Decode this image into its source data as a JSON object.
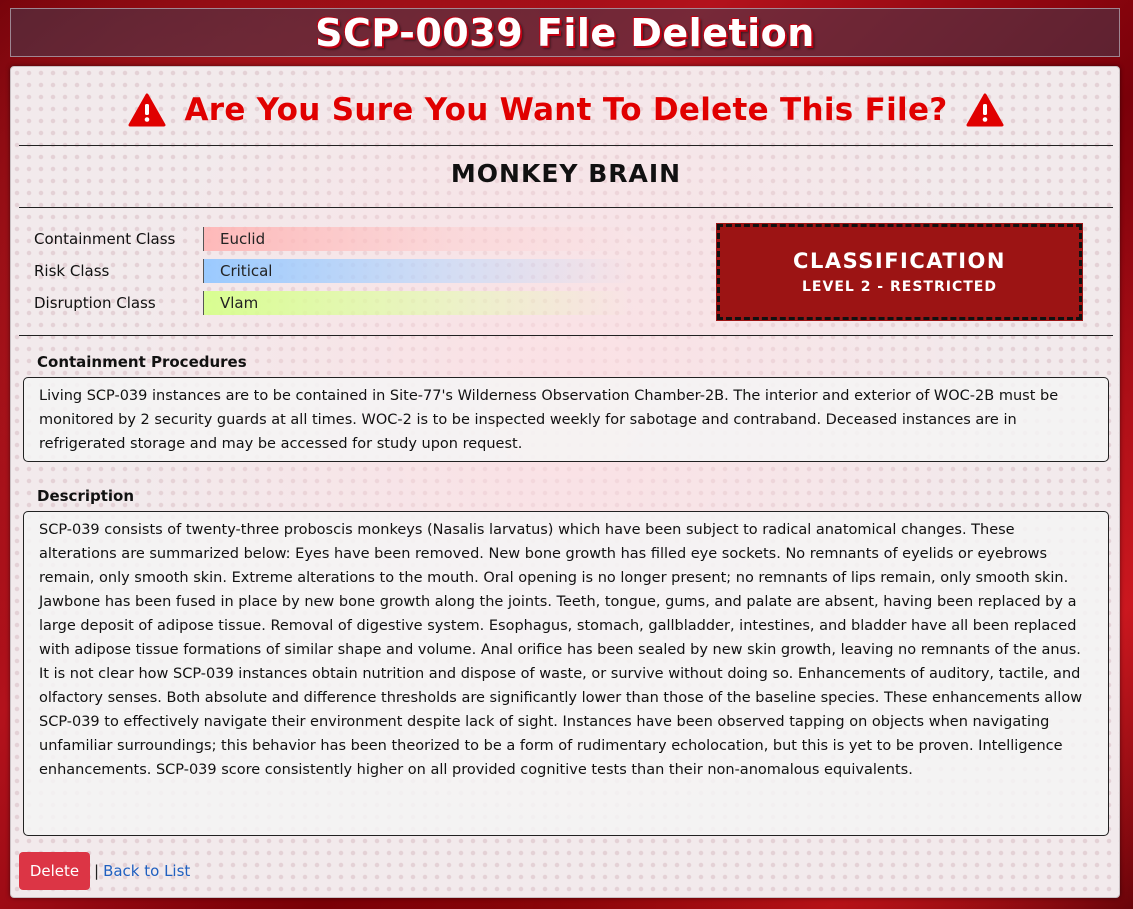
{
  "header": {
    "title": "SCP-0039 File Deletion"
  },
  "confirm": {
    "title": "Are You Sure You Want To Delete This File?"
  },
  "file": {
    "name": "MONKEY BRAIN"
  },
  "classes": [
    {
      "label": "Containment Class",
      "value": "Euclid",
      "color": "#ffb4b4"
    },
    {
      "label": "Risk Class",
      "value": "Critical",
      "color": "#96c8ff"
    },
    {
      "label": "Disruption Class",
      "value": "Vlam",
      "color": "#d7ff8c"
    }
  ],
  "classification": {
    "title": "CLASSIFICATION",
    "level": "LEVEL 2 - RESTRICTED",
    "color": "#9c1414"
  },
  "procedures": {
    "label": "Containment Procedures",
    "text": "Living SCP-039 instances are to be contained in Site-77's Wilderness Observation Chamber-2B. The interior and exterior of WOC-2B must be monitored by 2 security guards at all times. WOC-2 is to be inspected weekly for sabotage and contraband. Deceased instances are in refrigerated storage and may be accessed for study upon request."
  },
  "description": {
    "label": "Description",
    "text": "SCP-039 consists of twenty-three proboscis monkeys (Nasalis larvatus) which have been subject to radical anatomical changes. These alterations are summarized below: Eyes have been removed. New bone growth has filled eye sockets. No remnants of eyelids or eyebrows remain, only smooth skin. Extreme alterations to the mouth. Oral opening is no longer present; no remnants of lips remain, only smooth skin. Jawbone has been fused in place by new bone growth along the joints. Teeth, tongue, gums, and palate are absent, having been replaced by a large deposit of adipose tissue. Removal of digestive system. Esophagus, stomach, gallbladder, intestines, and bladder have all been replaced with adipose tissue formations of similar shape and volume. Anal orifice has been sealed by new skin growth, leaving no remnants of the anus. It is not clear how SCP-039 instances obtain nutrition and dispose of waste, or survive without doing so. Enhancements of auditory, tactile, and olfactory senses. Both absolute and difference thresholds are significantly lower than those of the baseline species. These enhancements allow SCP-039 to effectively navigate their environment despite lack of sight. Instances have been observed tapping on objects when navigating unfamiliar surroundings; this behavior has been theorized to be a form of rudimentary echolocation, but this is yet to be proven. Intelligence enhancements. SCP-039 score consistently higher on all provided cognitive tests than their non-anomalous equivalents."
  },
  "actions": {
    "delete_label": "Delete",
    "separator": "|",
    "back_label": "Back to List"
  },
  "colors": {
    "accent_red": "#e00000",
    "delete_button": "#dc3545",
    "link": "#2060c0"
  }
}
